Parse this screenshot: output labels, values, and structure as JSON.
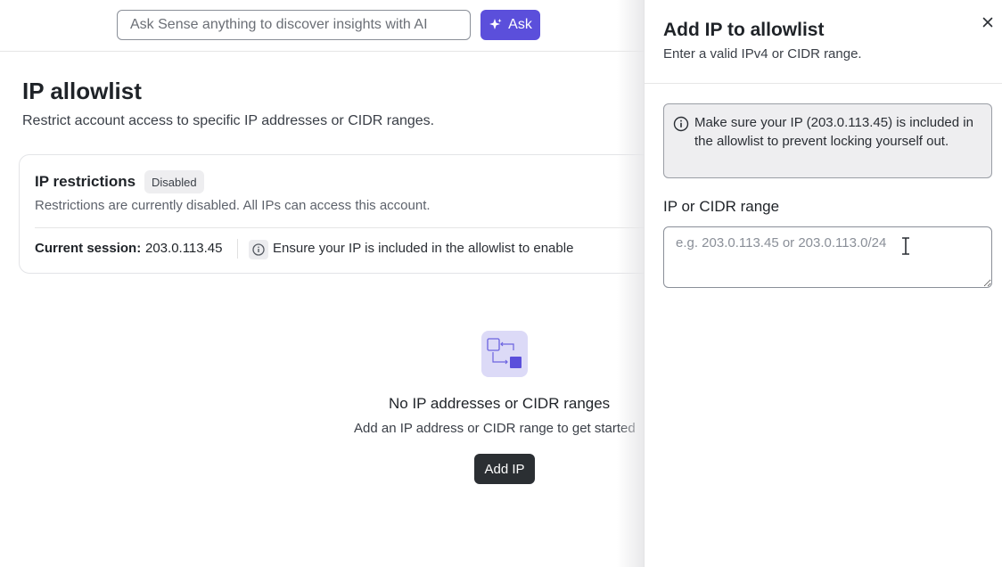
{
  "topbar": {
    "ask_placeholder": "Ask Sense anything to discover insights with AI",
    "ask_button_label": "Ask",
    "ask_button_icon": "sparkle-icon"
  },
  "page": {
    "title": "IP allowlist",
    "subtitle": "Restrict account access to specific IP addresses or CIDR ranges."
  },
  "restrictions_card": {
    "title": "IP restrictions",
    "badge": "Disabled",
    "description": "Restrictions are currently disabled. All IPs can access this account.",
    "session_label": "Current session:",
    "session_ip": "203.0.113.45",
    "info_text": "Ensure your IP is included in the allowlist to enable"
  },
  "empty_state": {
    "title": "No IP addresses or CIDR ranges",
    "description": "Add an IP address or CIDR range to get started",
    "button_label": "Add IP"
  },
  "drawer": {
    "title": "Add IP to allowlist",
    "subtitle": "Enter a valid IPv4 or CIDR range.",
    "alert_text": "Make sure your IP (203.0.113.45) is included in the allowlist to prevent locking yourself out.",
    "field_label": "IP or CIDR range",
    "field_placeholder": "e.g. 203.0.113.45 or 203.0.113.0/24",
    "field_value": ""
  },
  "colors": {
    "accent": "#5b4fdb",
    "dark_button": "#2b2f33",
    "empty_icon_bg": "#dcdaf7"
  }
}
